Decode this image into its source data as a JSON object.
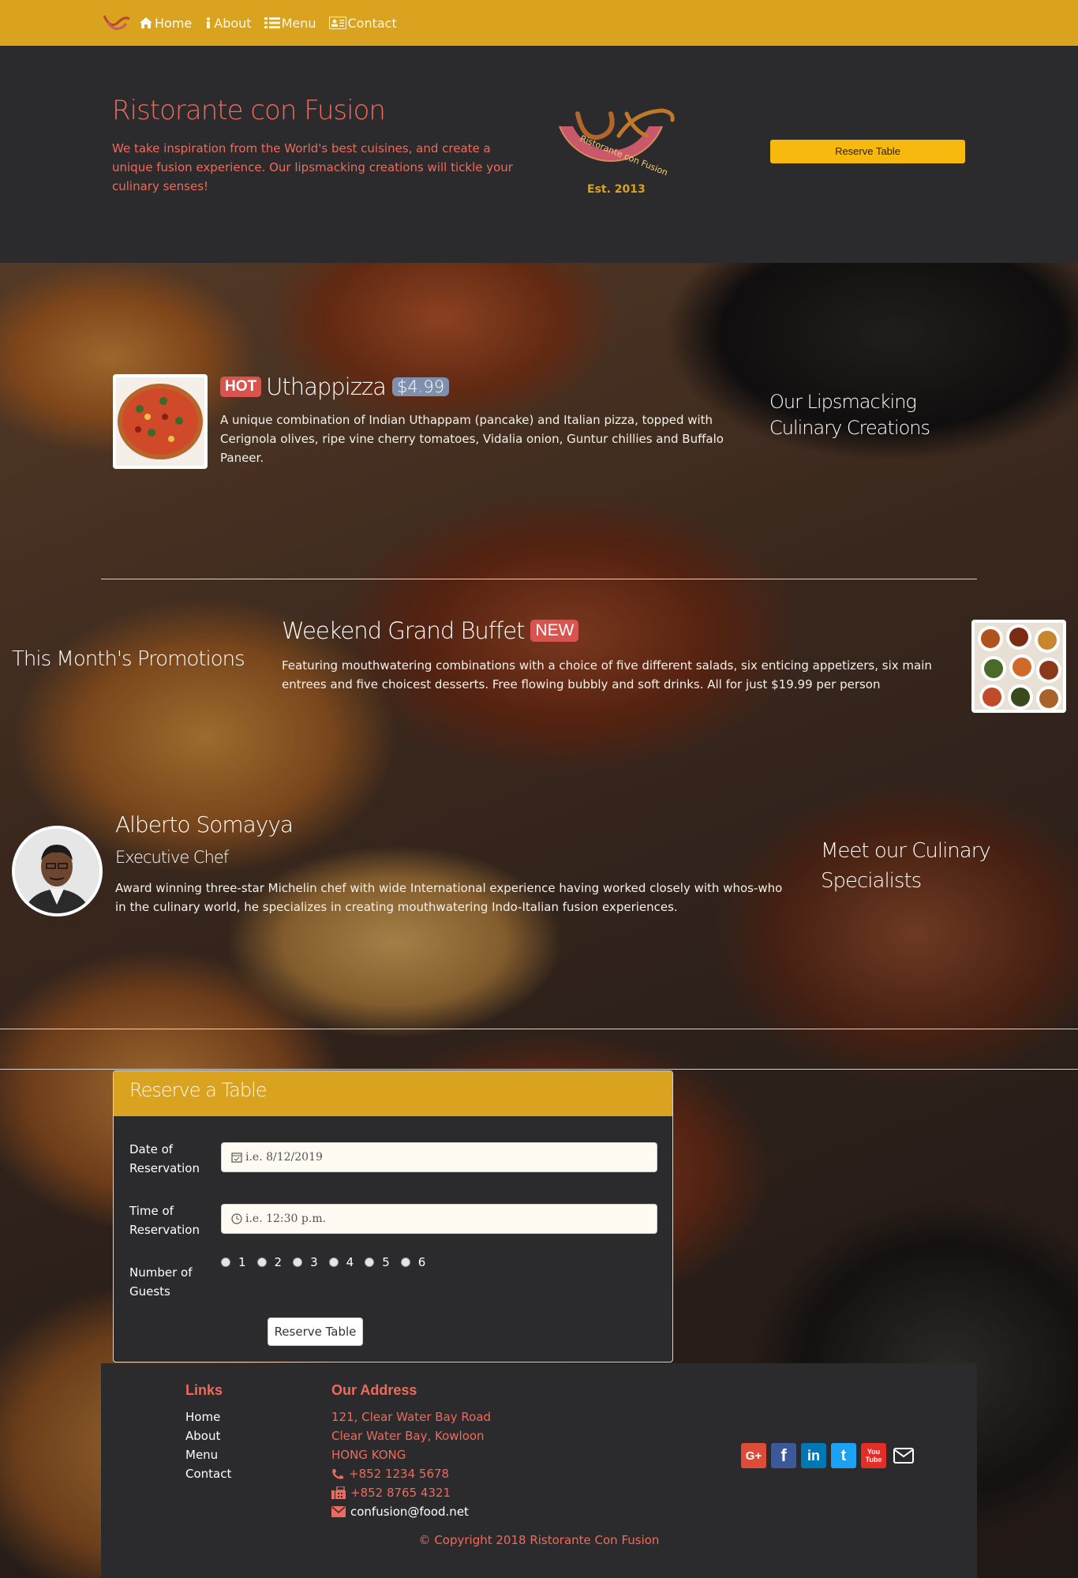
{
  "nav": {
    "items": [
      {
        "label": "Home",
        "icon": "home-icon",
        "active": true
      },
      {
        "label": "About",
        "icon": "info-icon",
        "active": false
      },
      {
        "label": "Menu",
        "icon": "list-icon",
        "active": false
      },
      {
        "label": "Contact",
        "icon": "address-card-icon",
        "active": false
      }
    ],
    "bg_color": "#d9a320"
  },
  "jumbotron": {
    "title": "Ristorante con Fusion",
    "description": "We take inspiration from the World's best cuisines, and create a unique fusion experience. Our lipsmacking creations will tickle your culinary senses!",
    "reserve_button": "Reserve Table",
    "logo_ring_text": "Ristorante con Fusion",
    "logo_est": "Est. 2013"
  },
  "dish": {
    "badge": "HOT",
    "name": "Uthappizza",
    "price": "$4.99",
    "description": "A unique combination of Indian Uthappam (pancake) and Italian pizza, topped with Cerignola olives, ripe vine cherry tomatoes, Vidalia onion, Guntur chillies and Buffalo Paneer.",
    "side_title": "Our Lipsmacking Culinary Creations"
  },
  "promotion": {
    "side_title": "This Month's Promotions",
    "name": "Weekend Grand Buffet",
    "badge": "NEW",
    "description": "Featuring mouthwatering combinations with a choice of five different salads, six enticing appetizers, six main entrees and five choicest desserts. Free flowing bubbly and soft drinks. All for just $19.99 per person"
  },
  "chef": {
    "name": "Alberto Somayya",
    "role": "Executive Chef",
    "description": "Award winning three-star Michelin chef with wide International experience having worked closely with whos-who in the culinary world, he specializes in creating mouthwatering Indo-Italian fusion experiences.",
    "side_title": "Meet our Culinary Specialists"
  },
  "reserve_form": {
    "title": "Reserve a Table",
    "date_label": "Date of Reservation",
    "date_placeholder": "i.e. 8/12/2019",
    "time_label": "Time of Reservation",
    "time_placeholder": "i.e. 12:30 p.m.",
    "guests_label": "Number of Guests",
    "guest_options": [
      "1",
      "2",
      "3",
      "4",
      "5",
      "6"
    ],
    "submit": "Reserve Table"
  },
  "footer": {
    "links_heading": "Links",
    "links": [
      "Home",
      "About",
      "Menu",
      "Contact"
    ],
    "address_heading": "Our Address",
    "address_lines": [
      "121, Clear Water Bay Road",
      "Clear Water Bay, Kowloon",
      "HONG KONG"
    ],
    "phone": "+852 1234 5678",
    "fax": "+852 8765 4321",
    "email": "confusion@food.net",
    "social": [
      {
        "name": "google-plus-icon",
        "label": "G+",
        "color": "#dd4b39"
      },
      {
        "name": "facebook-icon",
        "label": "f",
        "color": "#3b5998"
      },
      {
        "name": "linkedin-icon",
        "label": "in",
        "color": "#0077b5"
      },
      {
        "name": "twitter-icon",
        "label": "t",
        "color": "#1da1f2"
      },
      {
        "name": "youtube-icon",
        "label": "You Tube",
        "color": "#e52d27"
      },
      {
        "name": "mail-icon",
        "label": "",
        "color": "#ffffff"
      }
    ],
    "copyright": "© Copyright 2018 Ristorante Con Fusion"
  }
}
